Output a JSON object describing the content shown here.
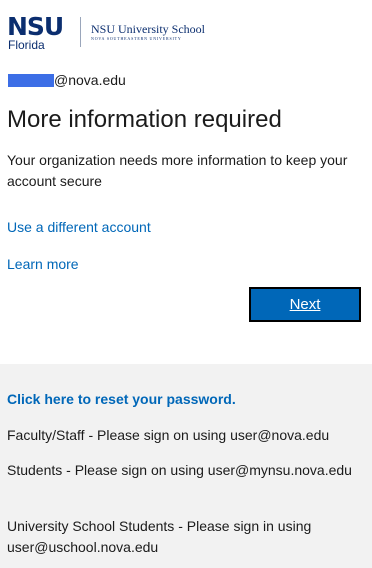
{
  "logo": {
    "nsu": "NSU",
    "florida": "Florida",
    "school_title": "NSU University School",
    "school_subtitle": "NOVA SOUTHEASTERN UNIVERSITY"
  },
  "identity": {
    "email_domain": "@nova.edu"
  },
  "main": {
    "title": "More information required",
    "description": "Your organization needs more information to keep your account secure",
    "use_different_account": "Use a different account",
    "learn_more": "Learn more",
    "next_label": "Next"
  },
  "footer": {
    "reset_link": "Click here to reset your password.",
    "line1": "Faculty/Staff - Please sign on using user@nova.edu",
    "line2": "Students - Please sign on using user@mynsu.nova.edu",
    "line3": "University School Students - Please sign in using user@uschool.nova.edu"
  },
  "colors": {
    "link": "#0067b8",
    "button": "#0067b8",
    "brand_navy": "#0b2e6f",
    "redaction": "#3c6ee6",
    "footer_bg": "#f2f2f2"
  }
}
